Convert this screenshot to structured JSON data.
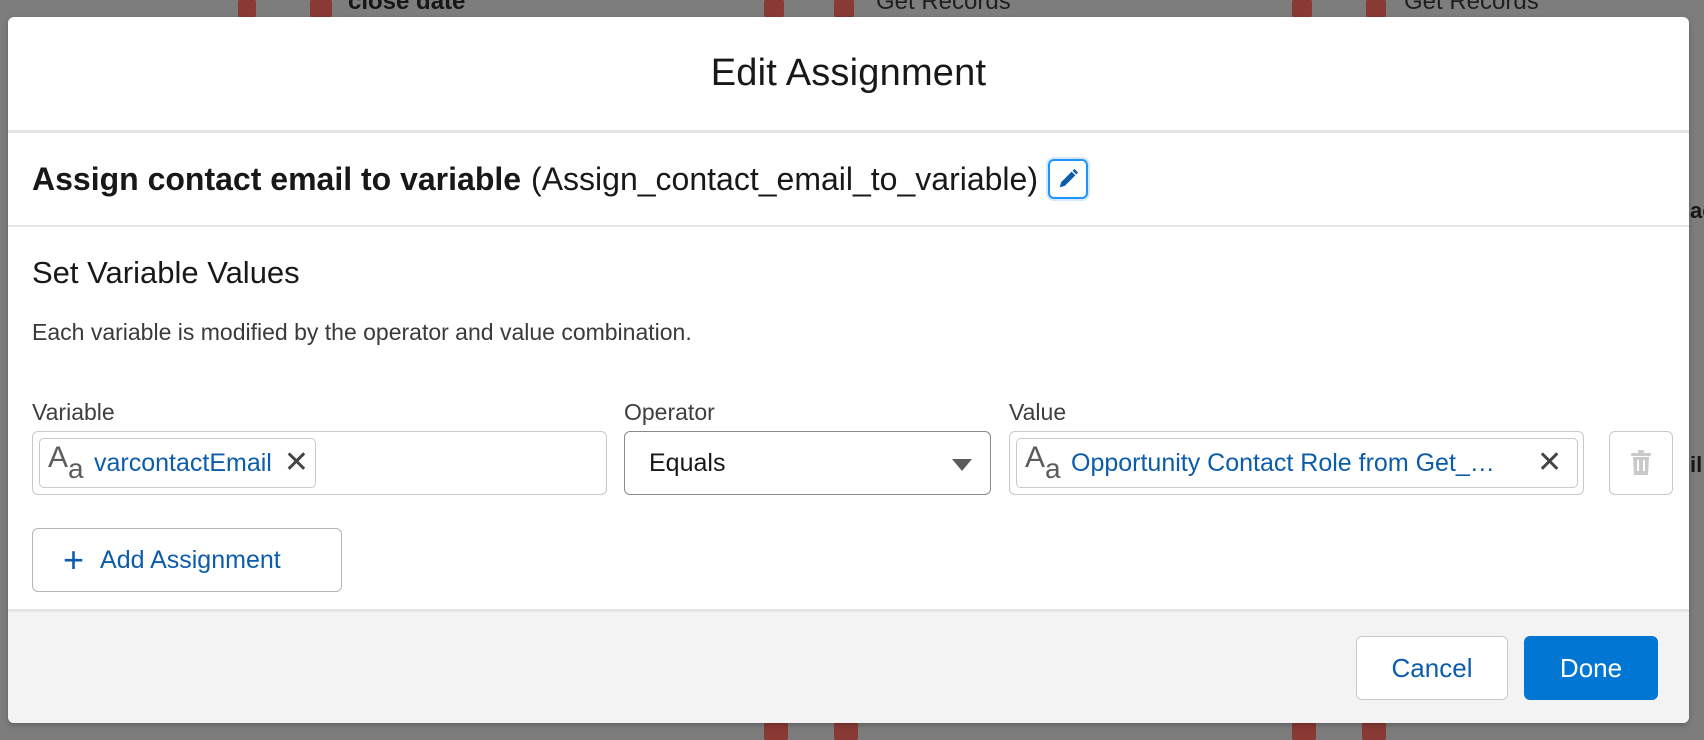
{
  "background": {
    "node_close_date": "close date",
    "node_get_records_1": "Get Records",
    "node_get_records_2": "Get Records",
    "right_edge_1": "ac",
    "right_edge_2": "il"
  },
  "modal": {
    "title": "Edit Assignment",
    "element_label": "Assign contact email to variable",
    "element_api_name": "(Assign_contact_email_to_variable)"
  },
  "section": {
    "heading": "Set Variable Values",
    "description": "Each variable is modified by the operator and value combination."
  },
  "assignment_row": {
    "variable_label": "Variable",
    "operator_label": "Operator",
    "value_label": "Value",
    "variable_value": "varcontactEmail",
    "operator_value": "Equals",
    "value_value": "Opportunity Contact Role from Get_…",
    "type_icon_big": "A",
    "type_icon_small": "a",
    "close_glyph": "✕"
  },
  "add_assignment_label": "Add Assignment",
  "add_plus_glyph": "+",
  "footer": {
    "cancel_label": "Cancel",
    "done_label": "Done"
  },
  "colors": {
    "primary": "#0176d3",
    "link": "#0b5cab",
    "node": "#8a3a34"
  }
}
